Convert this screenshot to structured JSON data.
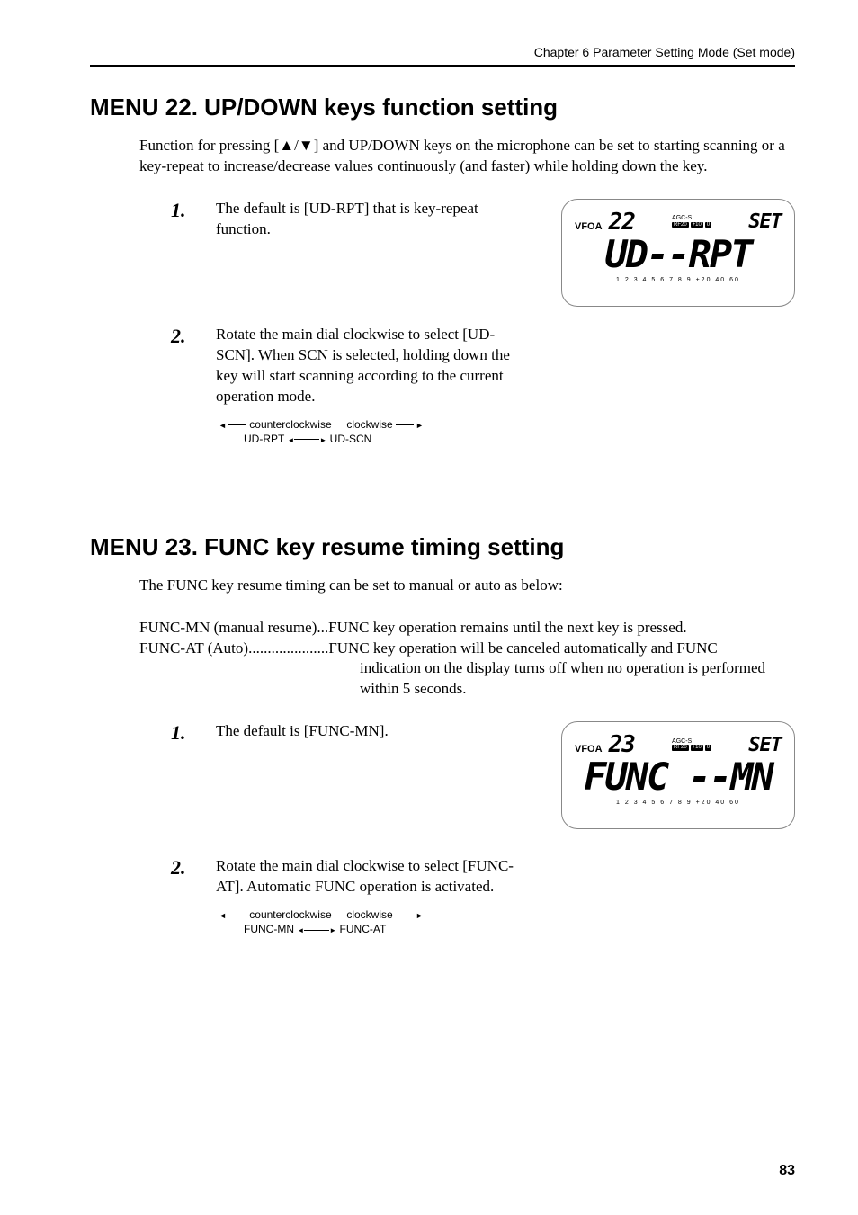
{
  "header": {
    "chapter_text": "Chapter 6   Parameter Setting Mode (Set mode)"
  },
  "menu22": {
    "title": "MENU 22. UP/DOWN keys function setting",
    "intro": "Function for pressing [▲/▼] and UP/DOWN keys on the microphone can be set to starting scanning or a key-repeat to increase/decrease values continuously (and faster) while holding down the key.",
    "step1_num": "1.",
    "step1_text": "The default is [UD-RPT] that is key-repeat function.",
    "step2_num": "2.",
    "step2_text": "Rotate the main dial clockwise to select [UD-SCN]. When SCN is selected, holding down the key will start scanning according to the current operation mode.",
    "rotate_ccw": "counterclockwise",
    "rotate_cw": "clockwise",
    "rotate_left_val": "UD-RPT",
    "rotate_right_val": "UD-SCN",
    "display": {
      "vfo": "VFOA",
      "menu_num": "22",
      "agc": "AGC-S",
      "rf20": "RF20",
      "plus10": "+10",
      "zero": "0",
      "set": "SET",
      "main": "UD--RPT",
      "scale": "1 2 3 4 5 6 7 8 9 +20 40 60"
    }
  },
  "menu23": {
    "title": "MENU 23. FUNC key resume timing setting",
    "intro": "The FUNC key resume timing can be set to manual or auto as below:",
    "desc1_label": "FUNC-MN (manual resume)",
    "desc1_dots": "...",
    "desc1_text": "FUNC key operation remains until the next key is pressed.",
    "desc2_label": "FUNC-AT (Auto)",
    "desc2_dots": ".....................",
    "desc2_text": "FUNC key operation will be canceled automatically and FUNC",
    "desc2_cont1": "indication on the display turns off when no operation is performed",
    "desc2_cont2": "within 5 seconds.",
    "step1_num": "1.",
    "step1_text": "The default is [FUNC-MN].",
    "step2_num": "2.",
    "step2_text": "Rotate the main dial clockwise to select [FUNC-AT]. Automatic FUNC operation is activated.",
    "rotate_ccw": "counterclockwise",
    "rotate_cw": "clockwise",
    "rotate_left_val": "FUNC-MN",
    "rotate_right_val": "FUNC-AT",
    "display": {
      "vfo": "VFOA",
      "menu_num": "23",
      "agc": "AGC-S",
      "rf20": "RF20",
      "plus10": "+10",
      "zero": "0",
      "set": "SET",
      "main": "FUNC --MN",
      "scale": "1 2 3 4 5 6 7 8 9 +20 40 60"
    }
  },
  "page_number": "83"
}
